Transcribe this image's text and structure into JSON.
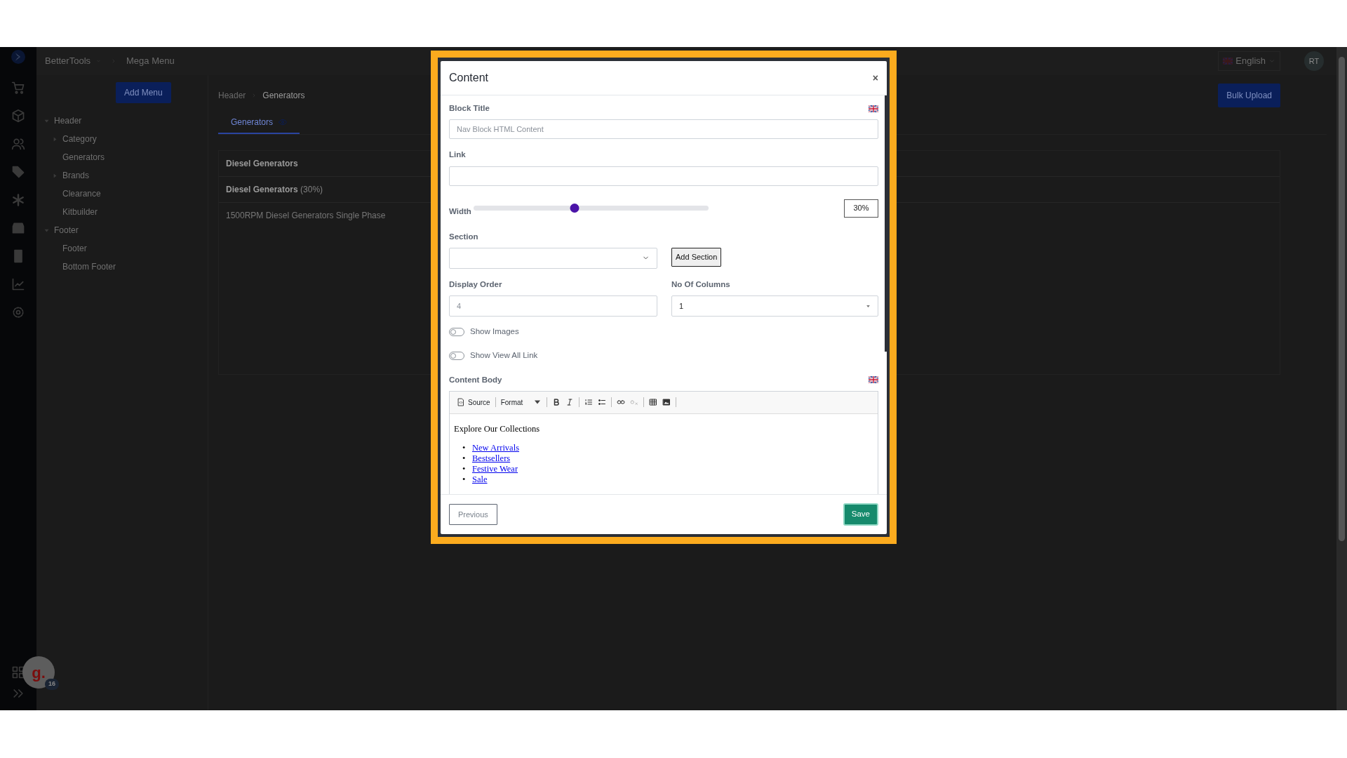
{
  "app": {
    "brand": "BetterTools",
    "page_title": "Mega Menu",
    "language": "English",
    "user_initials": "RT"
  },
  "menu_panel": {
    "add_button": "Add Menu",
    "tree": [
      {
        "label": "Header",
        "expanded": true,
        "children": [
          {
            "label": "Category",
            "expanded": false
          },
          {
            "label": "Generators"
          },
          {
            "label": "Brands",
            "expanded": false
          },
          {
            "label": "Clearance"
          },
          {
            "label": "Kitbuilder"
          }
        ]
      },
      {
        "label": "Footer",
        "expanded": true,
        "children": [
          {
            "label": "Footer"
          },
          {
            "label": "Bottom Footer"
          }
        ]
      }
    ]
  },
  "content_panel": {
    "breadcrumb": [
      "Header",
      "Generators"
    ],
    "bulk_button": "Bulk Upload",
    "tabs": [
      {
        "label": "Generators",
        "selected": true
      }
    ],
    "rows": [
      {
        "kind": "heading",
        "title": "Diesel Generators"
      },
      {
        "kind": "heading",
        "title": "Diesel Generators",
        "note": "(30%)"
      },
      {
        "kind": "item",
        "title": "1500RPM Diesel Generators Single Phase"
      }
    ]
  },
  "modal": {
    "title": "Content",
    "close": "×",
    "block_title": {
      "label": "Block Title",
      "placeholder": "Nav Block HTML Content"
    },
    "link": {
      "label": "Link"
    },
    "width": {
      "label": "Width",
      "level": 0.43,
      "reading": "30%"
    },
    "section": {
      "label": "Section",
      "add_button": "Add Section"
    },
    "display_order": {
      "label": "Display Order",
      "placeholder": "4"
    },
    "columns": {
      "label": "No Of Columns",
      "value": "1"
    },
    "toggles": [
      {
        "label": "Show Images",
        "on": false
      },
      {
        "label": "Show View All Link",
        "on": false
      }
    ],
    "content_body": {
      "label": "Content Body",
      "toolbar": {
        "source": "Source",
        "format": "Format"
      },
      "heading": "Explore Our Collections",
      "links": [
        {
          "marker": "•",
          "text": "New Arrivals"
        },
        {
          "marker": "•",
          "text": "Bestsellers"
        },
        {
          "marker": "•",
          "text": "Festive Wear"
        },
        {
          "marker": "•",
          "text": "Sale"
        }
      ]
    },
    "previous_button": "Previous",
    "save_button": "Save"
  },
  "chat_widget": {
    "logo": "g.",
    "badge": "16"
  }
}
